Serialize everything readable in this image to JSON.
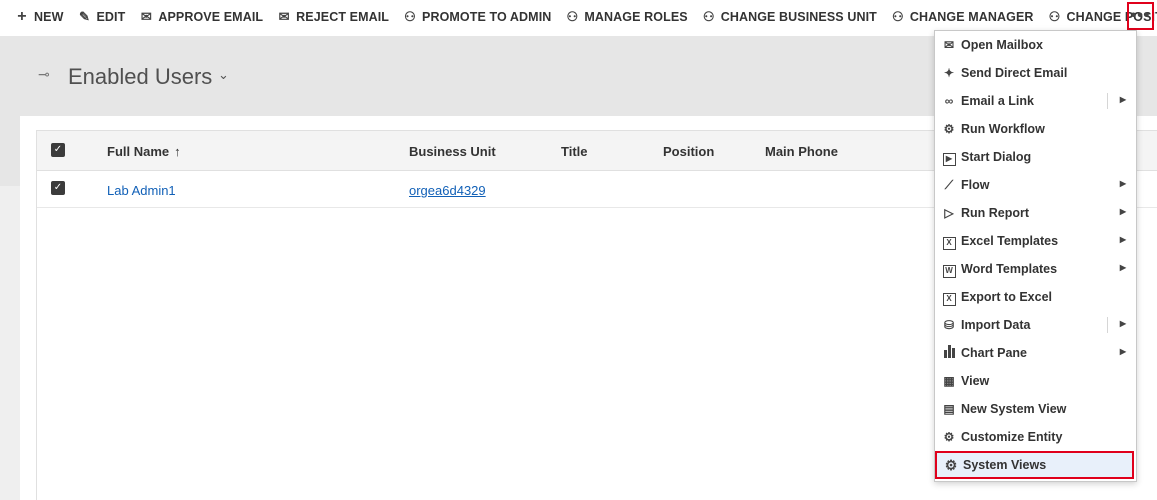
{
  "toolbar": {
    "new_label": "NEW",
    "edit_label": "EDIT",
    "approve_email_label": "APPROVE EMAIL",
    "reject_email_label": "REJECT EMAIL",
    "promote_admin_label": "PROMOTE TO ADMIN",
    "manage_roles_label": "MANAGE ROLES",
    "change_bu_label": "CHANGE BUSINESS UNIT",
    "change_manager_label": "CHANGE MANAGER",
    "change_position_label": "CHANGE POSITION",
    "more_label": "•••"
  },
  "view": {
    "title": "Enabled Users",
    "chevron": "⌄"
  },
  "grid": {
    "columns": [
      "Full Name",
      "Business Unit",
      "Title",
      "Position",
      "Main Phone"
    ],
    "sort_indicator": "↑",
    "rows": [
      {
        "full_name": "Lab Admin1",
        "business_unit": "orgea6d4329",
        "title": "",
        "position": "",
        "main_phone": ""
      }
    ]
  },
  "menu": {
    "items": [
      {
        "label": "Open Mailbox",
        "icon": "mailbox-icon"
      },
      {
        "label": "Send Direct Email",
        "icon": "wand-icon"
      },
      {
        "label": "Email a Link",
        "icon": "link-icon",
        "submenu": true
      },
      {
        "label": "Run Workflow",
        "icon": "workflow-icon"
      },
      {
        "label": "Start Dialog",
        "icon": "dialog-icon"
      },
      {
        "label": "Flow",
        "icon": "flow-icon",
        "submenu": true
      },
      {
        "label": "Run Report",
        "icon": "report-icon",
        "submenu": true
      },
      {
        "label": "Excel Templates",
        "icon": "excel-icon",
        "submenu": true
      },
      {
        "label": "Word Templates",
        "icon": "word-icon",
        "submenu": true
      },
      {
        "label": "Export to Excel",
        "icon": "export-excel-icon"
      },
      {
        "label": "Import Data",
        "icon": "import-data-icon",
        "submenu": true
      },
      {
        "label": "Chart Pane",
        "icon": "chart-icon",
        "submenu": true
      },
      {
        "label": "View",
        "icon": "view-grid-icon"
      },
      {
        "label": "New System View",
        "icon": "new-view-icon"
      },
      {
        "label": "Customize Entity",
        "icon": "customize-icon"
      },
      {
        "label": "System Views",
        "icon": "gear-icon",
        "highlighted": true
      }
    ]
  },
  "colors": {
    "accent_link": "#1160b7",
    "highlight_border": "#e0001b",
    "header_band": "#e6e6e6"
  }
}
